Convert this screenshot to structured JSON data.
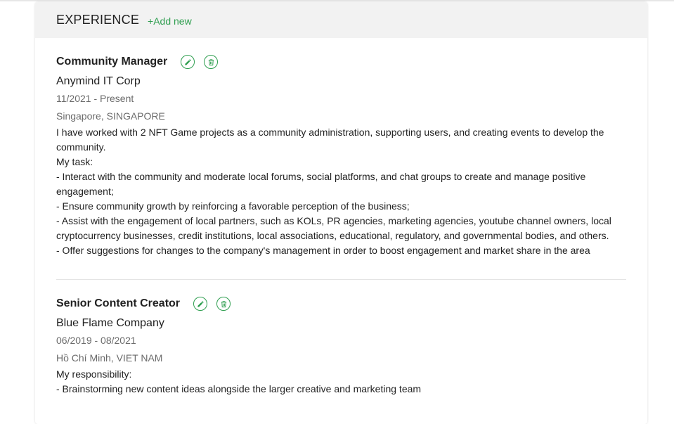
{
  "header": {
    "title": "EXPERIENCE",
    "add_label": "+Add new"
  },
  "colors": {
    "accent": "#2e9e4f",
    "header_bg": "#f2f2f2"
  },
  "experiences": [
    {
      "title": "Community Manager",
      "company": "Anymind IT Corp",
      "dates": "11/2021 - Present",
      "location": "Singapore, SINGAPORE",
      "description": "I have worked with 2 NFT Game projects as a community administration, supporting users, and creating events to develop the community.\nMy task:\n- Interact with the community and moderate local forums, social platforms, and chat groups to create and manage positive engagement;\n- Ensure community growth by reinforcing a favorable perception of the business;\n- Assist with the engagement of local partners, such as KOLs, PR agencies, marketing agencies, youtube channel owners, local cryptocurrency businesses, credit institutions, local associations, educational, regulatory, and governmental bodies, and others.\n- Offer suggestions for changes to the company's management in order to boost engagement and market share in the area"
    },
    {
      "title": "Senior Content Creator",
      "company": "Blue Flame Company",
      "dates": "06/2019 - 08/2021",
      "location": "Hồ Chí Minh, VIET NAM",
      "description": "My responsibility:\n- Brainstorming new content ideas alongside the larger creative and marketing team"
    }
  ]
}
